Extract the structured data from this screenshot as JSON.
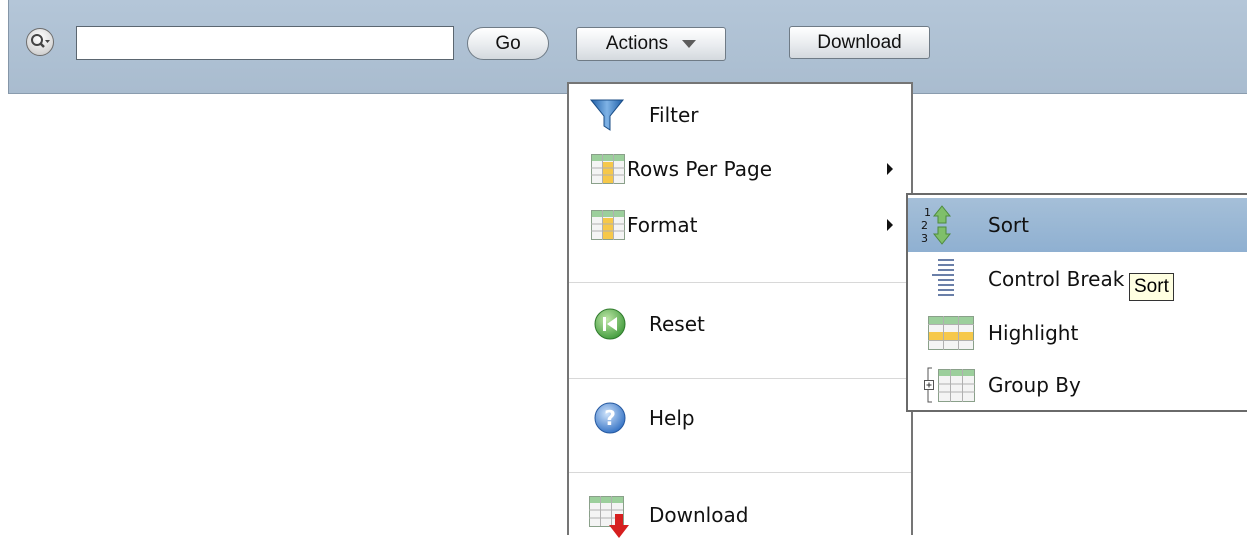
{
  "toolbar": {
    "search_value": "",
    "go_label": "Go",
    "actions_label": "Actions",
    "download_label": "Download",
    "search_menu_icon": "search-magnifier-dropdown-icon"
  },
  "actions_menu": {
    "items": [
      {
        "label": "Filter",
        "icon": "funnel-icon"
      },
      {
        "label": "Rows Per Page",
        "icon": "table-grid-icon",
        "has_submenu": true
      },
      {
        "label": "Format",
        "icon": "table-grid-icon",
        "has_submenu": true
      },
      {
        "label": "Reset",
        "icon": "reset-icon"
      },
      {
        "label": "Help",
        "icon": "help-icon"
      },
      {
        "label": "Download",
        "icon": "table-download-icon"
      }
    ]
  },
  "format_submenu": {
    "items": [
      {
        "label": "Sort",
        "icon": "sort-icon",
        "active": true
      },
      {
        "label": "Control Break",
        "icon": "control-break-icon"
      },
      {
        "label": "Highlight",
        "icon": "highlight-table-icon"
      },
      {
        "label": "Group By",
        "icon": "group-by-icon"
      }
    ]
  },
  "tooltip": {
    "text": "Sort"
  },
  "colors": {
    "toolbar_bg": "#adc0d3",
    "active_item_bg": "#9bb8d6",
    "tooltip_bg": "#ffffe1"
  }
}
